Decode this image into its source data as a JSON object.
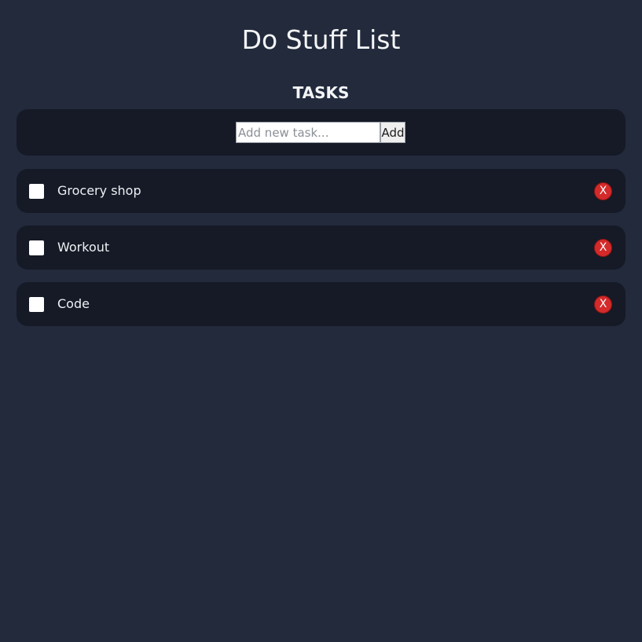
{
  "app": {
    "title": "Do Stuff List",
    "section_title": "TASKS"
  },
  "add_form": {
    "placeholder": "Add new task...",
    "value": "",
    "button_label": "Add"
  },
  "tasks": [
    {
      "label": "Grocery shop",
      "checked": false,
      "delete_label": "X"
    },
    {
      "label": "Workout",
      "checked": false,
      "delete_label": "X"
    },
    {
      "label": "Code",
      "checked": false,
      "delete_label": "X"
    }
  ],
  "colors": {
    "background": "#222a3c",
    "panel": "#151a26",
    "delete": "#d42a2a",
    "text": "#f4f5f7"
  }
}
